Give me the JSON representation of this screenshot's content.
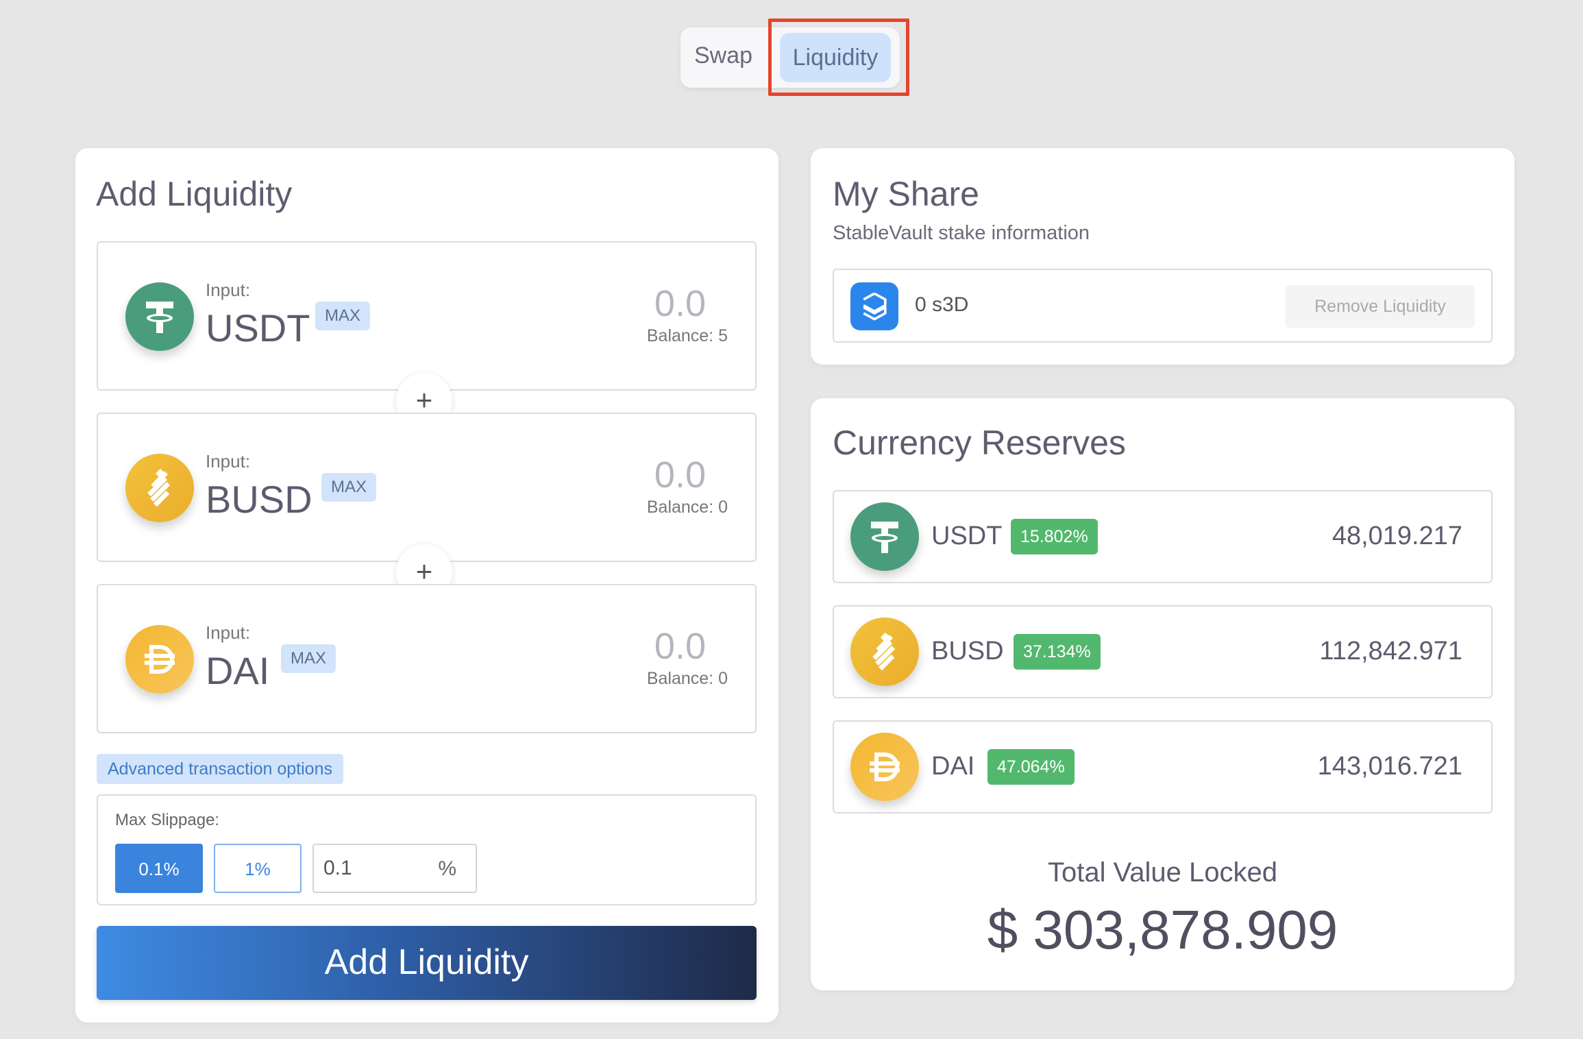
{
  "tabs": {
    "swap": "Swap",
    "liquidity": "Liquidity"
  },
  "add_liquidity": {
    "title": "Add Liquidity",
    "inputs": [
      {
        "label": "Input:",
        "token": "USDT",
        "max": "MAX",
        "amount": "0.0",
        "balance": "Balance: 5",
        "icon": "usdt-icon"
      },
      {
        "label": "Input:",
        "token": "BUSD",
        "max": "MAX",
        "amount": "0.0",
        "balance": "Balance: 0",
        "icon": "busd-icon"
      },
      {
        "label": "Input:",
        "token": "DAI",
        "max": "MAX",
        "amount": "0.0",
        "balance": "Balance: 0",
        "icon": "dai-icon"
      }
    ],
    "plus": "+",
    "advanced_options": "Advanced transaction options",
    "slippage": {
      "label": "Max Slippage:",
      "option_1": "0.1%",
      "option_2": "1%",
      "custom_value": "0.1",
      "unit": "%"
    },
    "button": "Add Liquidity"
  },
  "my_share": {
    "title": "My Share",
    "subtitle": "StableVault stake information",
    "amount": "0 s3D",
    "remove_button": "Remove Liquidity"
  },
  "reserves": {
    "title": "Currency Reserves",
    "rows": [
      {
        "token": "USDT",
        "percent": "15.802%",
        "value": "48,019.217"
      },
      {
        "token": "BUSD",
        "percent": "37.134%",
        "value": "112,842.971"
      },
      {
        "token": "DAI",
        "percent": "47.064%",
        "value": "143,016.721"
      }
    ],
    "tvl_label": "Total Value Locked",
    "tvl_value": "$ 303,878.909"
  },
  "colors": {
    "accent": "#3b84dd",
    "tab_active_bg": "#cfe2fb",
    "percent_badge": "#52b86d",
    "highlight": "#e3462c"
  }
}
